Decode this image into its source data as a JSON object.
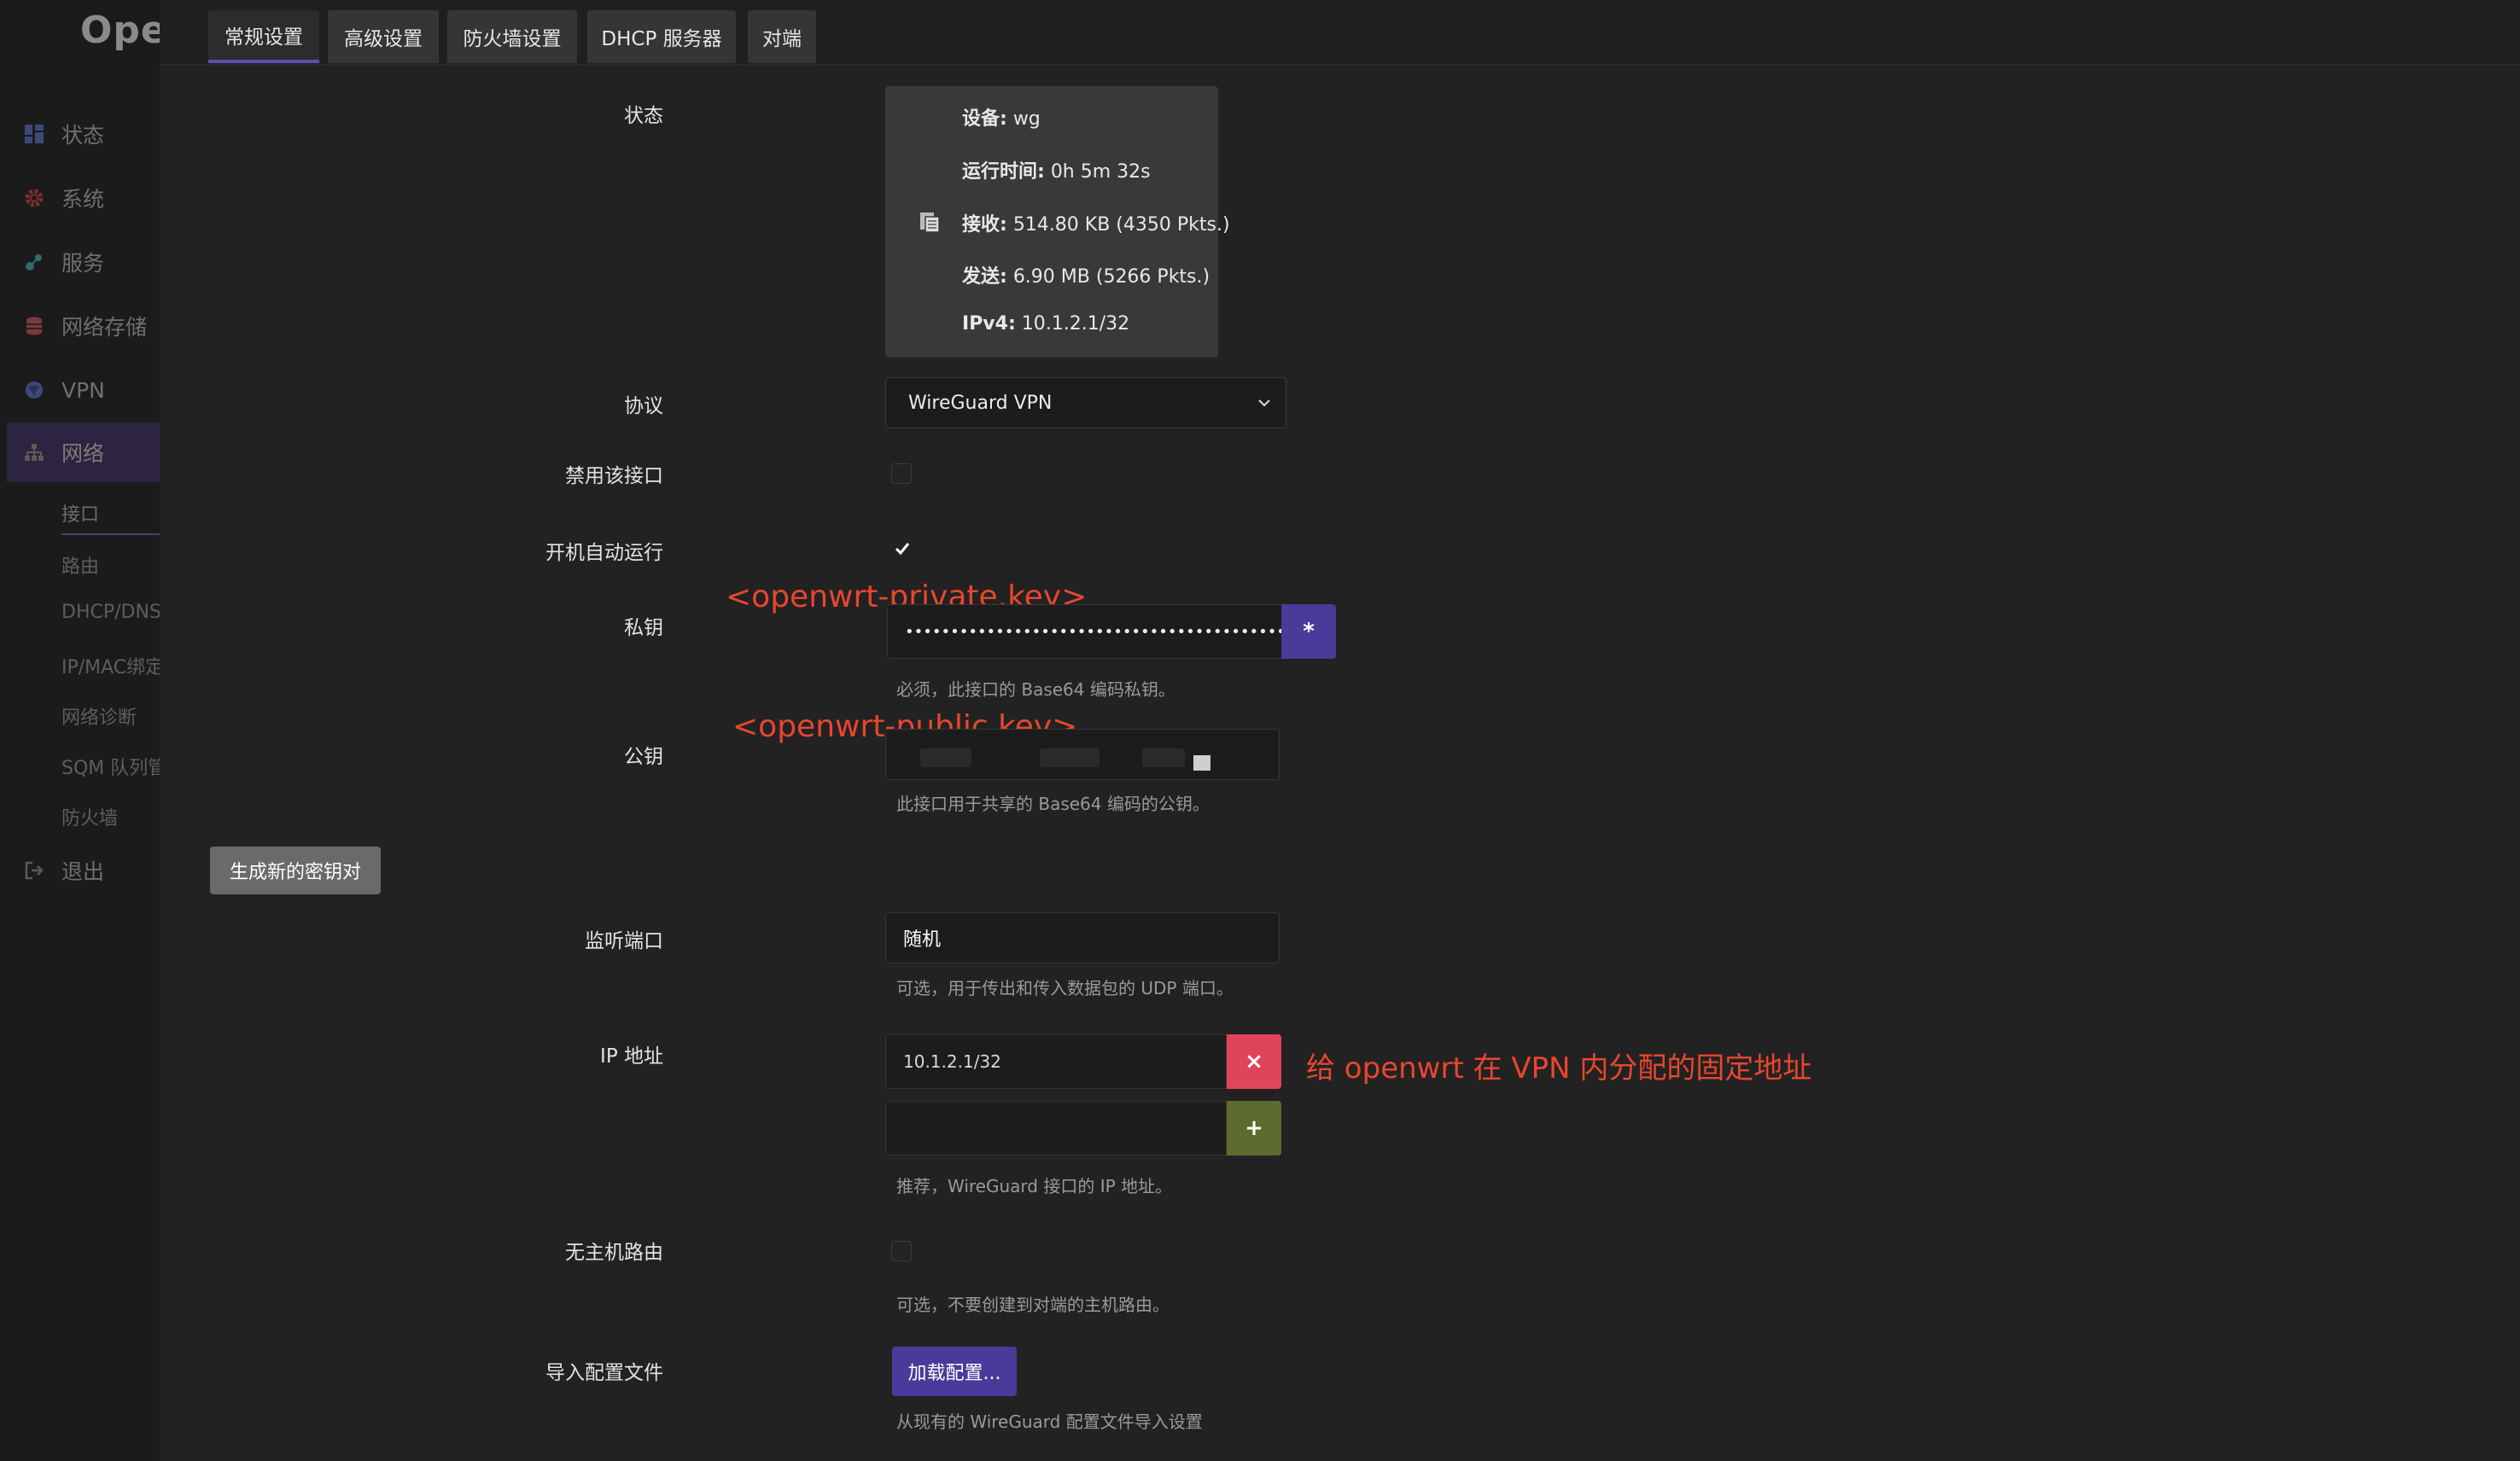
{
  "brand": {
    "logo_text": "Ope"
  },
  "sidebar": {
    "items": [
      {
        "label": "状态",
        "icon": "dashboard-icon",
        "color": "#3b4a78"
      },
      {
        "label": "系统",
        "icon": "gear-icon",
        "color": "#7a2f2f"
      },
      {
        "label": "服务",
        "icon": "services-icon",
        "color": "#2f6d6a"
      },
      {
        "label": "网络存储",
        "icon": "storage-icon",
        "color": "#7a3b3b"
      },
      {
        "label": "VPN",
        "icon": "vpn-icon",
        "color": "#3b4a78"
      },
      {
        "label": "网络",
        "icon": "network-icon",
        "color": "#5b5b5b"
      }
    ],
    "sub_items": [
      "接口",
      "路由",
      "DHCP/DNS",
      "IP/MAC绑定",
      "网络诊断",
      "SQM 队列管",
      "防火墙"
    ],
    "logout_label": "退出"
  },
  "tabs": [
    "常规设置",
    "高级设置",
    "防火墙设置",
    "DHCP 服务器",
    "对端"
  ],
  "form": {
    "status_label": "状态",
    "status": {
      "device_key": "设备:",
      "device_val": "wg",
      "uptime_key": "运行时间:",
      "uptime_val": "0h 5m 32s",
      "rx_key": "接收:",
      "rx_val": "514.80 KB (4350 Pkts.)",
      "tx_key": "发送:",
      "tx_val": "6.90 MB (5266 Pkts.)",
      "ipv4_key": "IPv4:",
      "ipv4_val": "10.1.2.1/32"
    },
    "protocol_label": "协议",
    "protocol_value": "WireGuard VPN",
    "disable_label": "禁用该接口",
    "autostart_label": "开机自动运行",
    "private_key_label": "私钥",
    "private_key_value": "•••••••••••••••••••••••••••••••••••••••••••••••",
    "private_key_reveal": "*",
    "private_key_help": "必须，此接口的 Base64 编码私钥。",
    "public_key_label": "公钥",
    "public_key_help": "此接口用于共享的 Base64 编码的公钥。",
    "generate_button": "生成新的密钥对",
    "listen_port_label": "监听端口",
    "listen_port_value": "随机",
    "listen_port_help": "可选，用于传出和传入数据包的 UDP 端口。",
    "ip_label": "IP 地址",
    "ip_value": "10.1.2.1/32",
    "ip_remove": "×",
    "ip_add": "+",
    "ip_help": "推荐，WireGuard 接口的 IP 地址。",
    "no_host_route_label": "无主机路由",
    "no_host_route_help": "可选，不要创建到对端的主机路由。",
    "import_label": "导入配置文件",
    "import_button": "加载配置...",
    "import_help": "从现有的 WireGuard 配置文件导入设置"
  },
  "annotations": {
    "private_key": "<openwrt-private.key>",
    "public_key": "<openwrt-public.key>",
    "ip_address": "给 openwrt 在 VPN 内分配的固定地址"
  },
  "colors": {
    "accent": "#4a3a9a",
    "remove": "#e0445a",
    "add": "#5c6b2e",
    "annotation": "#e8462e"
  }
}
